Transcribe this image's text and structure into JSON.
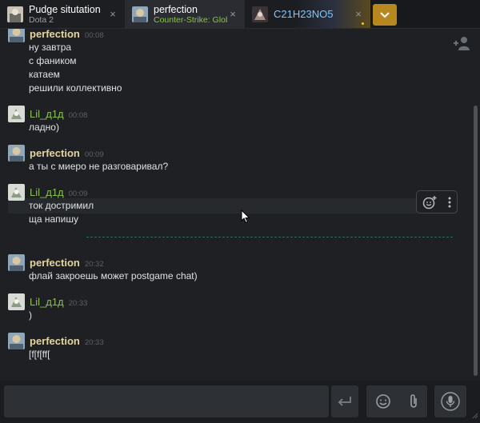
{
  "tabs": [
    {
      "name": "Pudge situtation",
      "game": "Dota 2",
      "active": false
    },
    {
      "name": "perfection",
      "game": "Counter-Strike: Global Offensive",
      "active": true
    },
    {
      "name": "C21H23NO5",
      "game": "",
      "active": false
    }
  ],
  "close_symbol": "×",
  "icons": {
    "tab_dropdown": "chevron-down-icon",
    "add_friend": "add-friend-icon",
    "emoji_reaction": "emoji-reaction-icon",
    "more": "more-options-icon",
    "send": "enter-icon",
    "emoji": "emoji-icon",
    "attach": "paperclip-icon",
    "voice": "microphone-icon"
  },
  "colors": {
    "accent_dropdown": "#b78720",
    "author_self": "#e4d5a0",
    "author_friend": "#8bc24d",
    "in_game": "#8bc24d",
    "tab_link": "#7cc7ff"
  },
  "messages": [
    {
      "author": "perfection",
      "time": "00:08",
      "lines": [
        "ну завтра",
        "с фаником",
        "катаем",
        "решили коллективно"
      ]
    },
    {
      "author": "Lil_д1д",
      "time": "00:08",
      "lines": [
        "ладно)"
      ]
    },
    {
      "author": "perfection",
      "time": "00:09",
      "lines": [
        "а ты с миеро не разговаривал?"
      ]
    },
    {
      "author": "Lil_д1д",
      "time": "00:09",
      "lines": [
        "ток достримил",
        "ща напишу"
      ]
    },
    {
      "author": "perfection",
      "time": "20:32",
      "lines": [
        "флай закроешь может postgame chat)"
      ]
    },
    {
      "author": "Lil_д1д",
      "time": "20:33",
      "lines": [
        ")"
      ]
    },
    {
      "author": "perfection",
      "time": "20:33",
      "lines": [
        "[f[f[ff["
      ]
    }
  ],
  "composer": {
    "value": "",
    "placeholder": ""
  }
}
